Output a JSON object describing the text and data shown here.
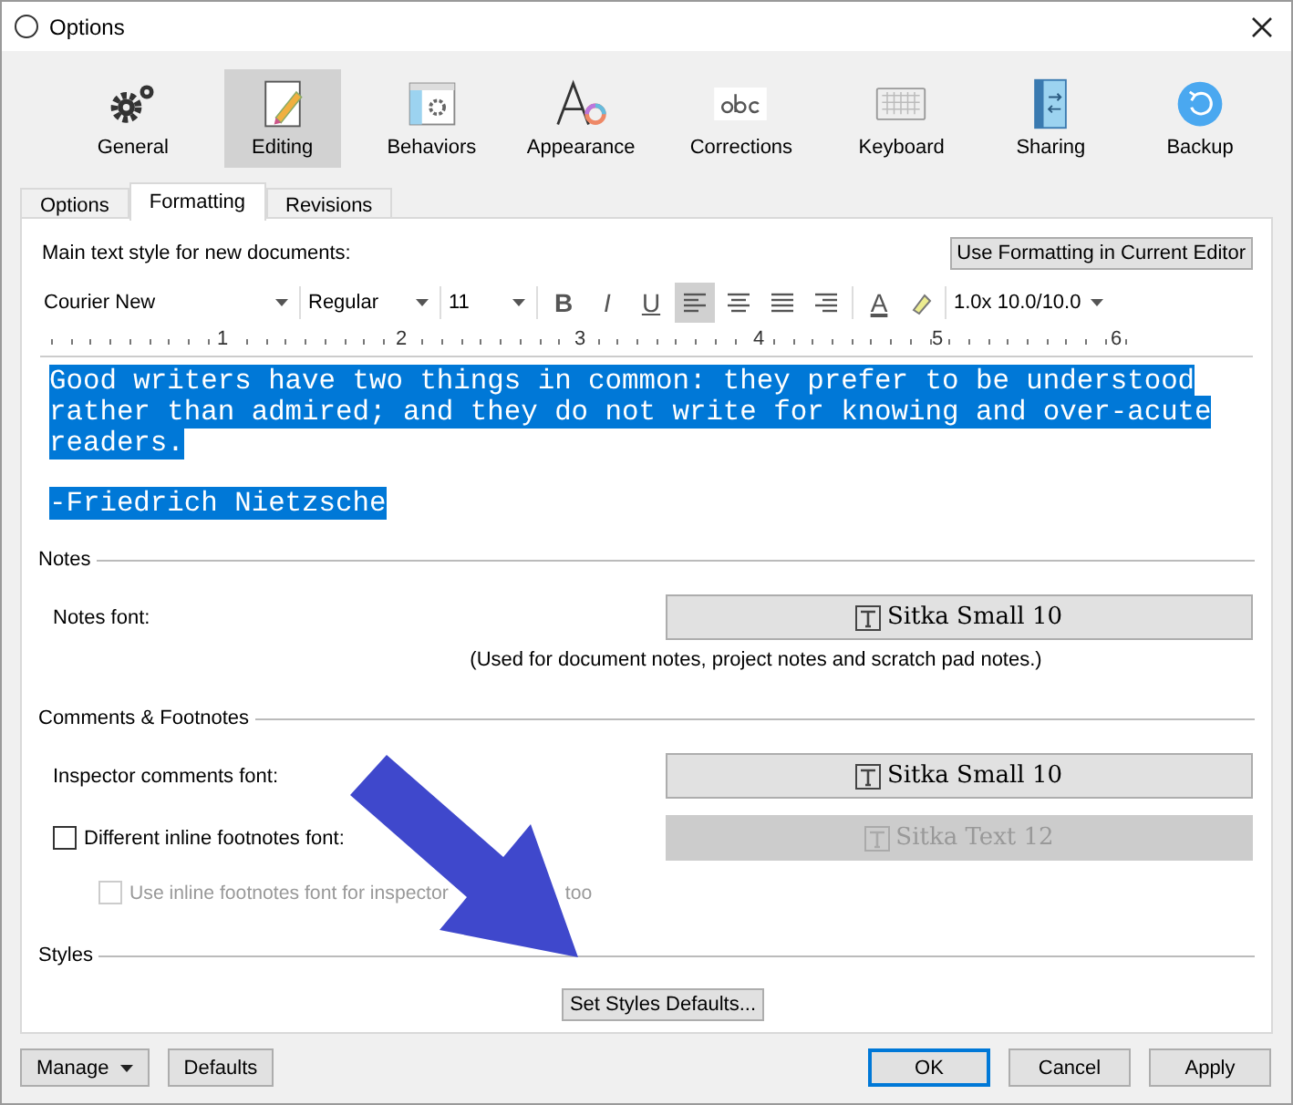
{
  "window": {
    "title": "Options"
  },
  "toolbar": [
    {
      "label": "General",
      "kind": "gears",
      "selected": false
    },
    {
      "label": "Editing",
      "kind": "pencil",
      "selected": true
    },
    {
      "label": "Behaviors",
      "kind": "window",
      "selected": false
    },
    {
      "label": "Appearance",
      "kind": "letter",
      "selected": false
    },
    {
      "label": "Corrections",
      "kind": "abc",
      "selected": false
    },
    {
      "label": "Keyboard",
      "kind": "keyboard",
      "selected": false
    },
    {
      "label": "Sharing",
      "kind": "book",
      "selected": false
    },
    {
      "label": "Backup",
      "kind": "backup",
      "selected": false
    }
  ],
  "tabs": [
    {
      "label": "Options",
      "selected": false
    },
    {
      "label": "Formatting",
      "selected": true
    },
    {
      "label": "Revisions",
      "selected": false
    }
  ],
  "formatting": {
    "label": "Main text style for new documents:",
    "button": "Use Formatting in Current Editor",
    "font": "Courier New",
    "style": "Regular",
    "size": "11",
    "styles": [
      {
        "kind": "bold",
        "label": "B",
        "selected": false
      },
      {
        "kind": "italic",
        "label": "I",
        "selected": false
      },
      {
        "kind": "underline",
        "label": "U",
        "selected": false
      }
    ],
    "alignments": [
      {
        "kind": "left",
        "selected": true
      },
      {
        "kind": "center",
        "selected": false
      },
      {
        "kind": "justify",
        "selected": false
      },
      {
        "kind": "right",
        "selected": false
      }
    ],
    "text_color_label": "A",
    "spacing": "1.0x 10.0/10.0",
    "ruler": [
      "1",
      "2",
      "3",
      "4",
      "5",
      "6"
    ],
    "sample": [
      [
        "Good writers have two things in common: they prefer to be understood",
        "rather than admired; and they do not write for knowing and over-acute",
        "readers."
      ],
      [
        "-Friedrich Nietzsche"
      ]
    ]
  },
  "notes": {
    "heading": "Notes",
    "label": "Notes font:",
    "font_button": "Sitka Small 10",
    "caption": "(Used for document notes, project notes and scratch pad notes.)"
  },
  "comments": {
    "heading": "Comments & Footnotes",
    "inspector_label": "Inspector comments font:",
    "inspector_font": "Sitka Small 10",
    "inline": {
      "label": "Different inline footnotes font:",
      "checked": false,
      "font_button": "Sitka Text 12",
      "font_disabled": true
    },
    "use_inline": {
      "label": "Use inline footnotes font for inspector",
      "label_end": "too",
      "checked": false,
      "disabled": true
    }
  },
  "styles": {
    "heading": "Styles",
    "button": "Set Styles Defaults..."
  },
  "footer": {
    "left": [
      {
        "label": "Manage",
        "kind": "menu"
      },
      {
        "label": "Defaults",
        "kind": "plain"
      }
    ],
    "right": [
      {
        "label": "OK",
        "kind": "default"
      },
      {
        "label": "Cancel",
        "kind": "plain"
      },
      {
        "label": "Apply",
        "kind": "plain"
      }
    ]
  }
}
